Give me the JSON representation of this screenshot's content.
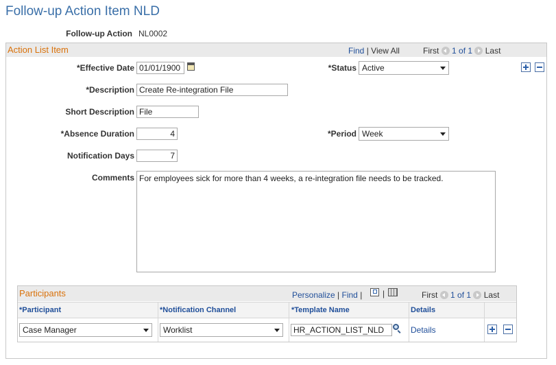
{
  "page_title": "Follow-up Action Item NLD",
  "followup": {
    "label": "Follow-up Action",
    "value": "NL0002"
  },
  "action_list": {
    "title": "Action List Item",
    "find": "Find",
    "sep": "|",
    "view_all": "View All",
    "first": "First",
    "count": "1 of 1",
    "last": "Last"
  },
  "fields": {
    "effective_date": {
      "label": "*Effective Date",
      "value": "01/01/1900"
    },
    "status": {
      "label": "*Status",
      "value": "Active"
    },
    "description": {
      "label": "*Description",
      "value": "Create Re-integration File"
    },
    "short_description": {
      "label": "Short Description",
      "value": "File"
    },
    "absence_duration": {
      "label": "*Absence Duration",
      "value": "4"
    },
    "period": {
      "label": "*Period",
      "value": "Week"
    },
    "notification_days": {
      "label": "Notification Days",
      "value": "7"
    },
    "comments": {
      "label": "Comments",
      "value": "For employees sick for more than 4 weeks, a re-integration file needs to be tracked."
    }
  },
  "participants": {
    "title": "Participants",
    "personalize": "Personalize",
    "sep": "|",
    "find": "Find",
    "first": "First",
    "count": "1 of 1",
    "last": "Last",
    "columns": [
      "*Participant",
      "*Notification Channel",
      "*Template Name",
      "Details"
    ],
    "rows": [
      {
        "participant": "Case Manager",
        "channel": "Worklist",
        "template": "HR_ACTION_LIST_NLD",
        "details": "Details"
      }
    ]
  },
  "icons": {
    "calendar": "calendar-icon",
    "lookup": "magnifier-icon",
    "add": "plus-icon",
    "remove": "minus-icon",
    "zoom": "zoom-icon",
    "download": "spreadsheet-icon"
  },
  "colors": {
    "title": "#3a6fa8",
    "section": "#d9710a",
    "link": "#1f4e99"
  }
}
